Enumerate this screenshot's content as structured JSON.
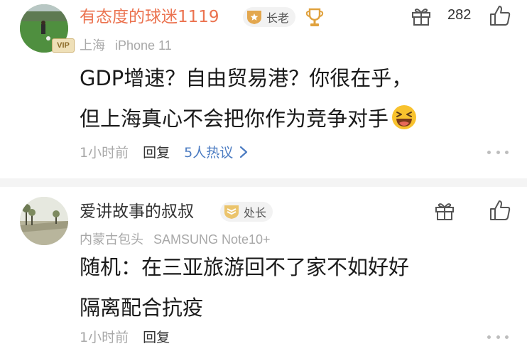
{
  "comments": [
    {
      "username": "有态度的球迷1119",
      "vip_label": "VIP",
      "level": "长老",
      "location": "上海",
      "device": "iPhone 11",
      "content_line1": "GDP增速？自由贸易港？你很在乎，",
      "content_line2": "但上海真心不会把你作为竞争对手",
      "time": "1小时前",
      "reply_label": "回复",
      "hot_replies": "5人热议",
      "like_count": "282"
    },
    {
      "username": "爱讲故事的叔叔",
      "level": "处长",
      "location": "内蒙古包头",
      "device": "SAMSUNG Note10+",
      "content_line1": "随机：在三亚旅游回不了家不如好好",
      "content_line2": "隔离配合抗疫",
      "time": "1小时前",
      "reply_label": "回复"
    }
  ],
  "colors": {
    "username_highlight": "#eb7350",
    "link_blue": "#4c7cc2",
    "meta_gray": "#a8a8a8"
  },
  "icons": [
    "gift-icon",
    "like-icon",
    "more-icon",
    "trophy-icon",
    "shield-badge-icon",
    "laughing-emoji",
    "chevron-right-icon"
  ]
}
